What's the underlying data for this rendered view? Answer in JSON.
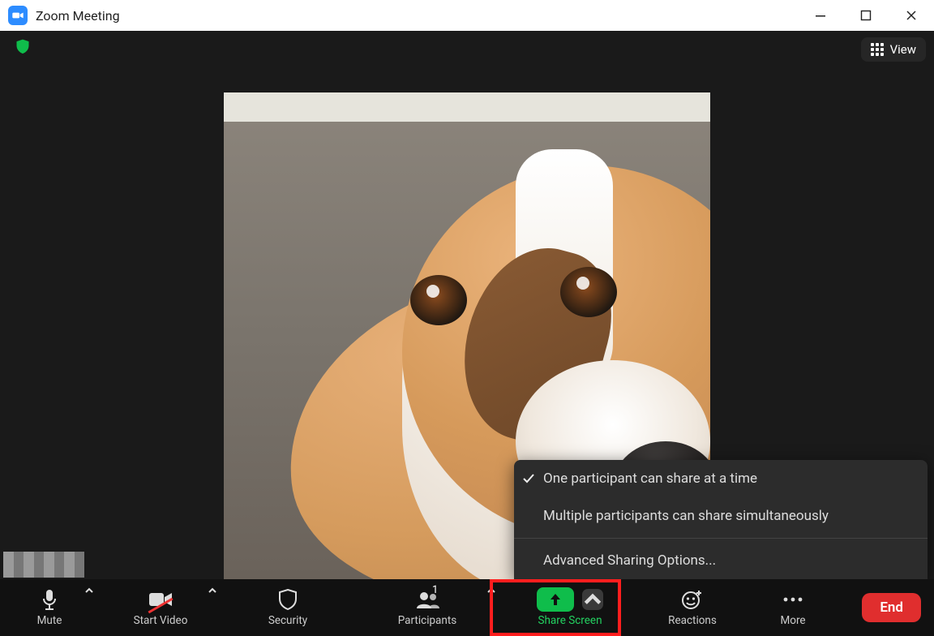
{
  "title": "Zoom Meeting",
  "view_button": "View",
  "toolbar": {
    "mute": "Mute",
    "start_video": "Start Video",
    "security": "Security",
    "participants": "Participants",
    "participants_count": "1",
    "share_screen": "Share Screen",
    "reactions": "Reactions",
    "more": "More",
    "end": "End"
  },
  "share_menu": {
    "opt1": "One participant can share at a time",
    "opt2": "Multiple participants can share simultaneously",
    "advanced": "Advanced Sharing Options..."
  }
}
